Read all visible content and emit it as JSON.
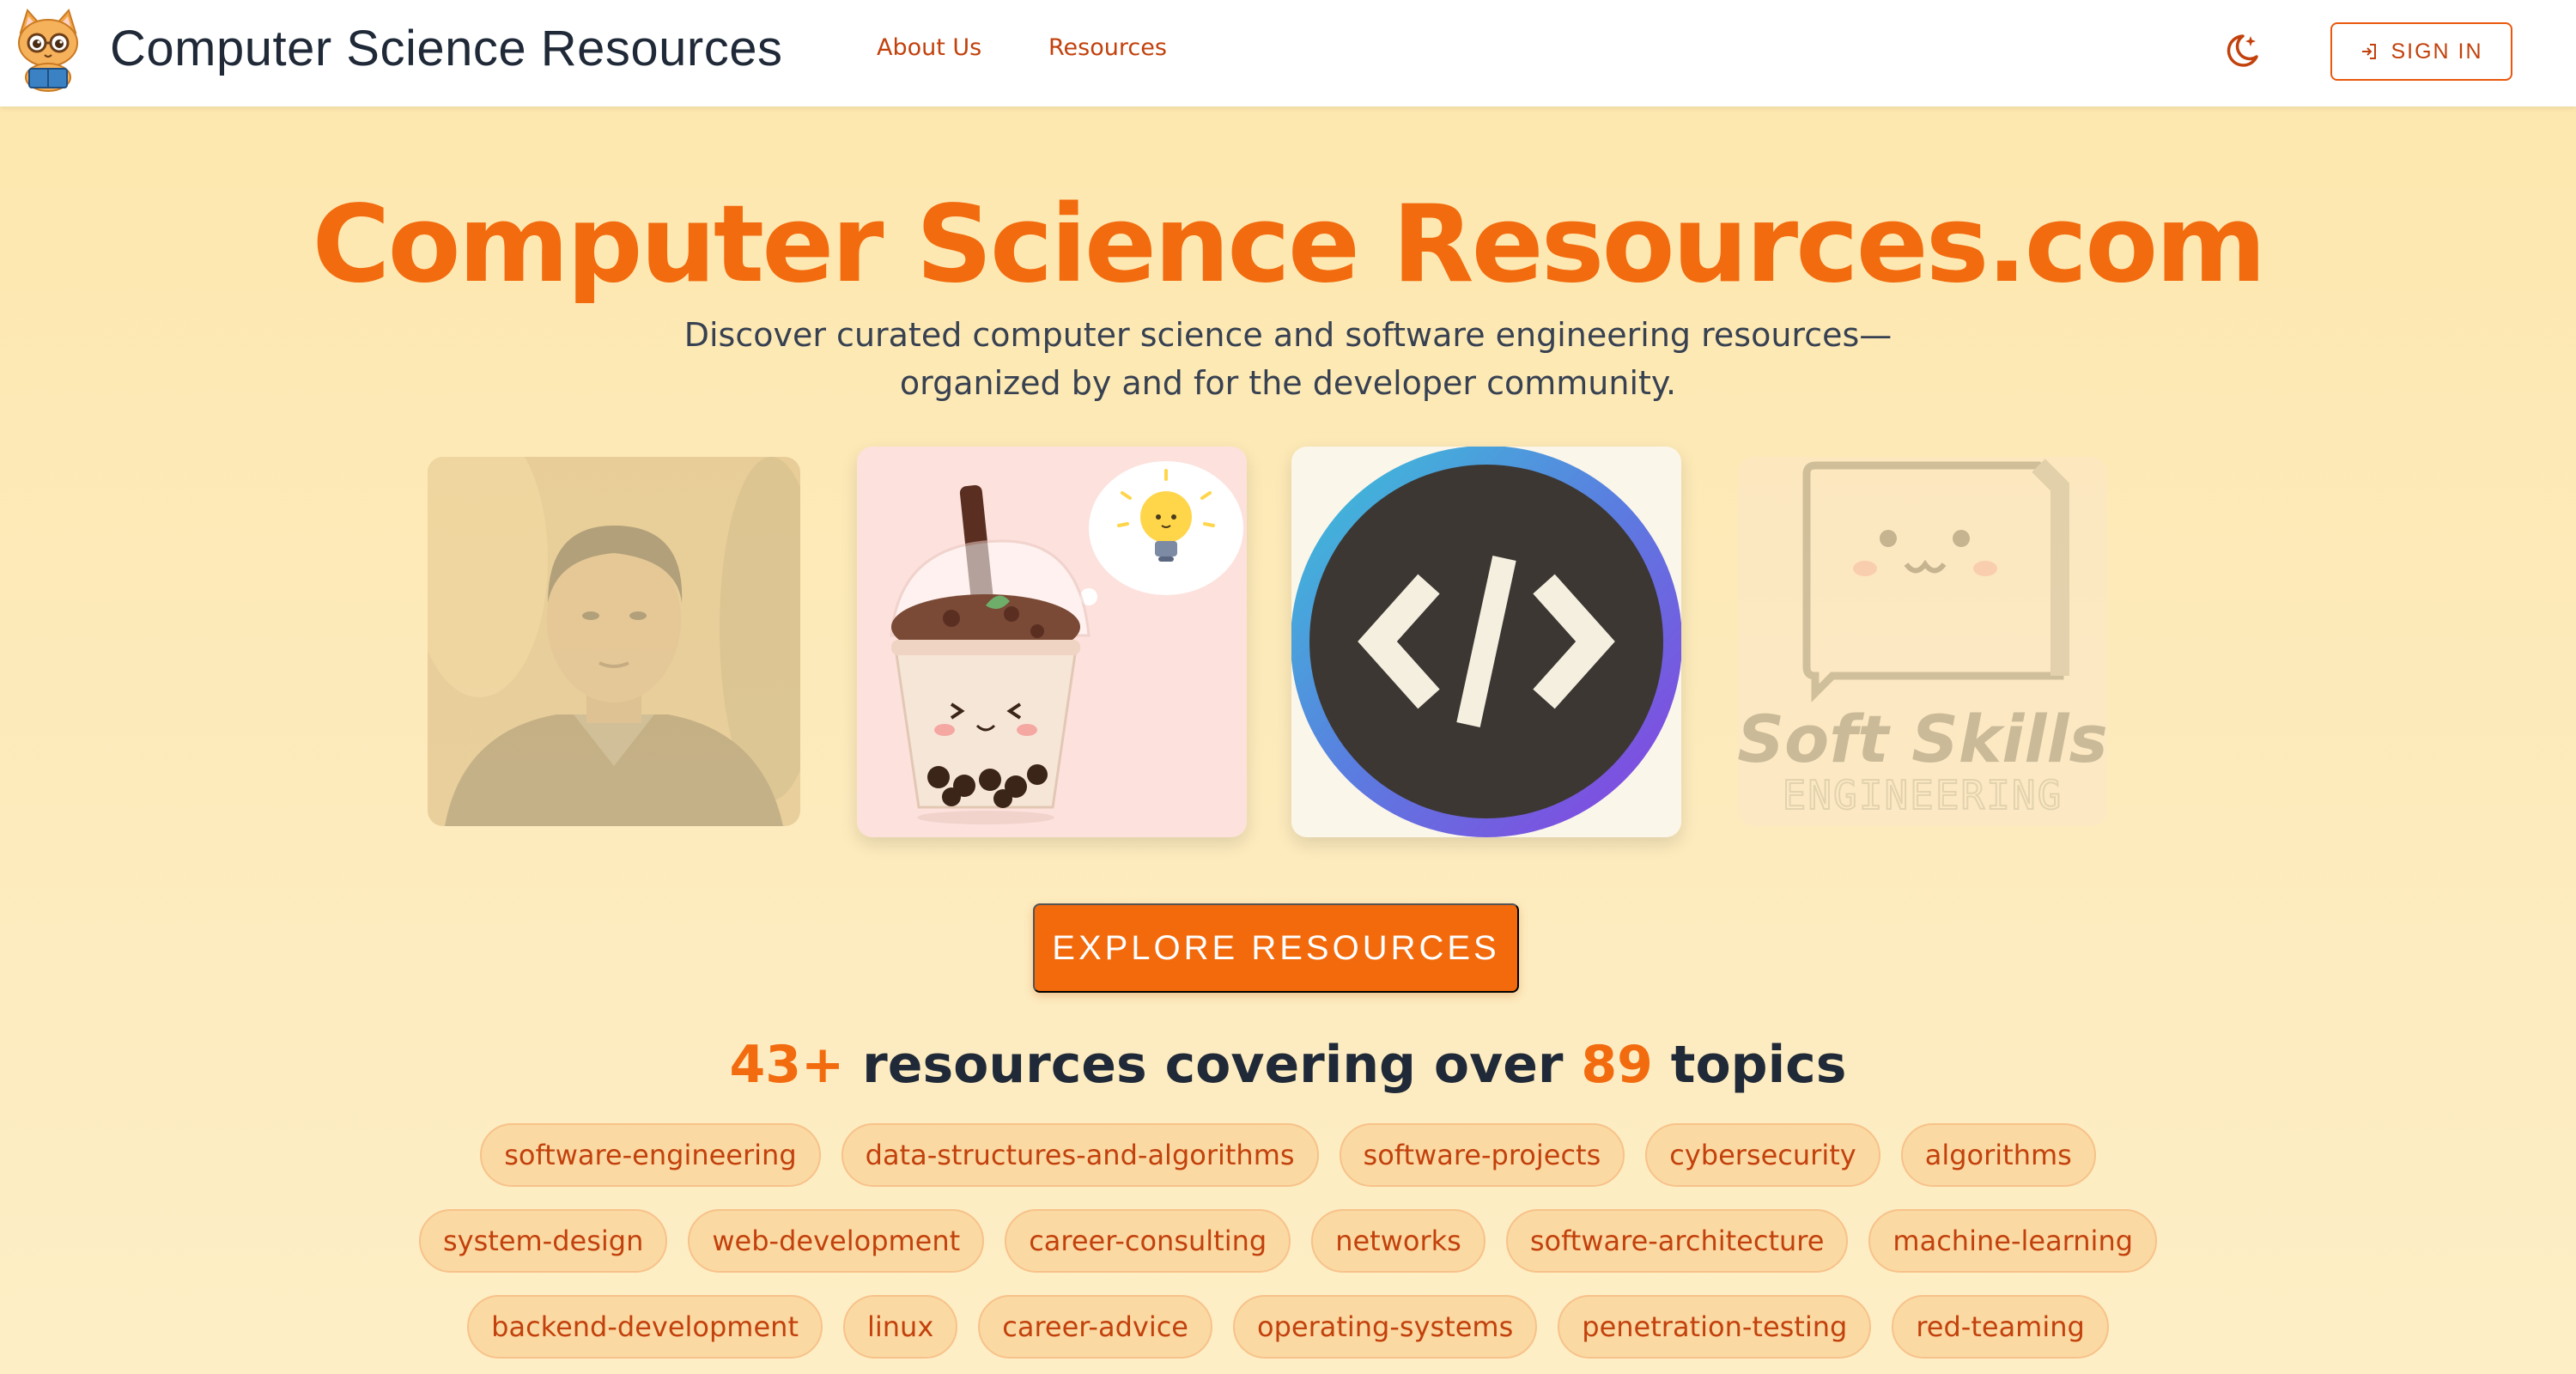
{
  "navbar": {
    "brand": "Computer Science Resources",
    "links": [
      {
        "label": "About Us"
      },
      {
        "label": "Resources"
      }
    ],
    "theme_icon": "moon-stars-icon",
    "signin_label": "SIGN IN",
    "signin_icon": "login-icon"
  },
  "hero": {
    "title": "Computer Science Resources.com",
    "subtitle_line1": "Discover curated computer science and software engineering resources—",
    "subtitle_line2": "organized by and for the developer community."
  },
  "carousel": {
    "cards": [
      {
        "name": "person-portrait",
        "icon": "portrait-image"
      },
      {
        "name": "boba-tea-illustration",
        "icon": "boba-lightbulb-image"
      },
      {
        "name": "code-logo",
        "icon": "code-brackets-icon"
      },
      {
        "name": "soft-skills-engineering",
        "logo_text_1": "Soft Skills",
        "logo_text_2": "ENGINEERING"
      }
    ]
  },
  "cta": {
    "explore_label": "EXPLORE RESOURCES"
  },
  "stats": {
    "resource_count": "43+",
    "text_mid": " resources covering over ",
    "topic_count": "89",
    "text_end": " topics"
  },
  "tags": {
    "rows": [
      [
        "software-engineering",
        "data-structures-and-algorithms",
        "software-projects",
        "cybersecurity",
        "algorithms"
      ],
      [
        "system-design",
        "web-development",
        "career-consulting",
        "networks",
        "software-architecture",
        "machine-learning"
      ],
      [
        "backend-development",
        "linux",
        "career-advice",
        "operating-systems",
        "penetration-testing",
        "red-teaming"
      ]
    ]
  },
  "colors": {
    "accent": "#f26b0f",
    "link": "#c2410c",
    "background": "#fde7ad",
    "tag_bg": "#fbd9a3"
  }
}
